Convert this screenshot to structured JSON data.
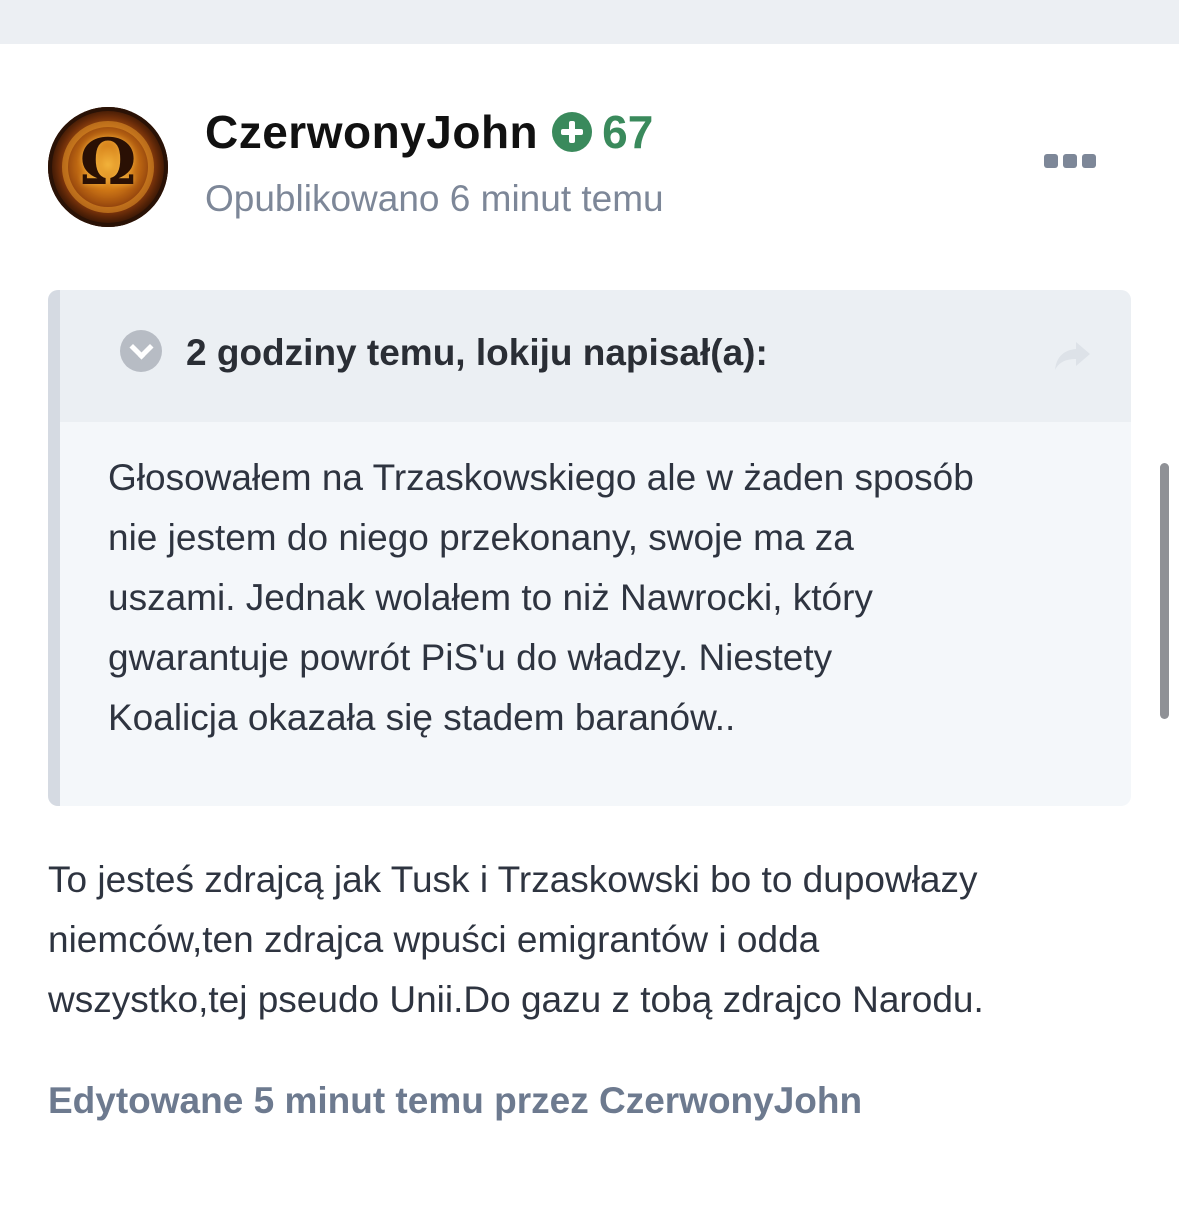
{
  "post": {
    "author": {
      "name": "CzerwonyJohn",
      "reputation": "67",
      "avatar_icon": "omega-avatar-icon"
    },
    "meta": "Opublikowano 6 minut temu",
    "more_icon": "ellipsis-icon",
    "quote": {
      "citation": "2 godziny temu, lokiju napisał(a):",
      "toggle_icon": "chevron-down-icon",
      "share_icon": "share-arrow-icon",
      "lines": [
        "Głosowałem na Trzaskowskiego ale w żaden sposób",
        "nie jestem do niego przekonany, swoje ma za",
        "uszami. Jednak wolałem to niż Nawrocki, który",
        "gwarantuje powrót PiS'u do władzy. Niestety",
        "Koalicja okazała się stadem baranów.."
      ]
    },
    "body_lines": [
      "To jesteś zdrajcą jak Tusk i Trzaskowski bo to dupowłazy",
      "niemców,ten zdrajca wpuści emigrantów i odda",
      "wszystko,tej pseudo Unii.Do gazu z tobą zdrajco Narodu."
    ],
    "edited": "Edytowane 5 minut temu przez CzerwonyJohn"
  },
  "colors": {
    "reputation_green": "#3a8a5c",
    "meta_gray": "#7d8798",
    "quote_background": "#f4f7fa",
    "quote_header": "#ebeff3"
  }
}
